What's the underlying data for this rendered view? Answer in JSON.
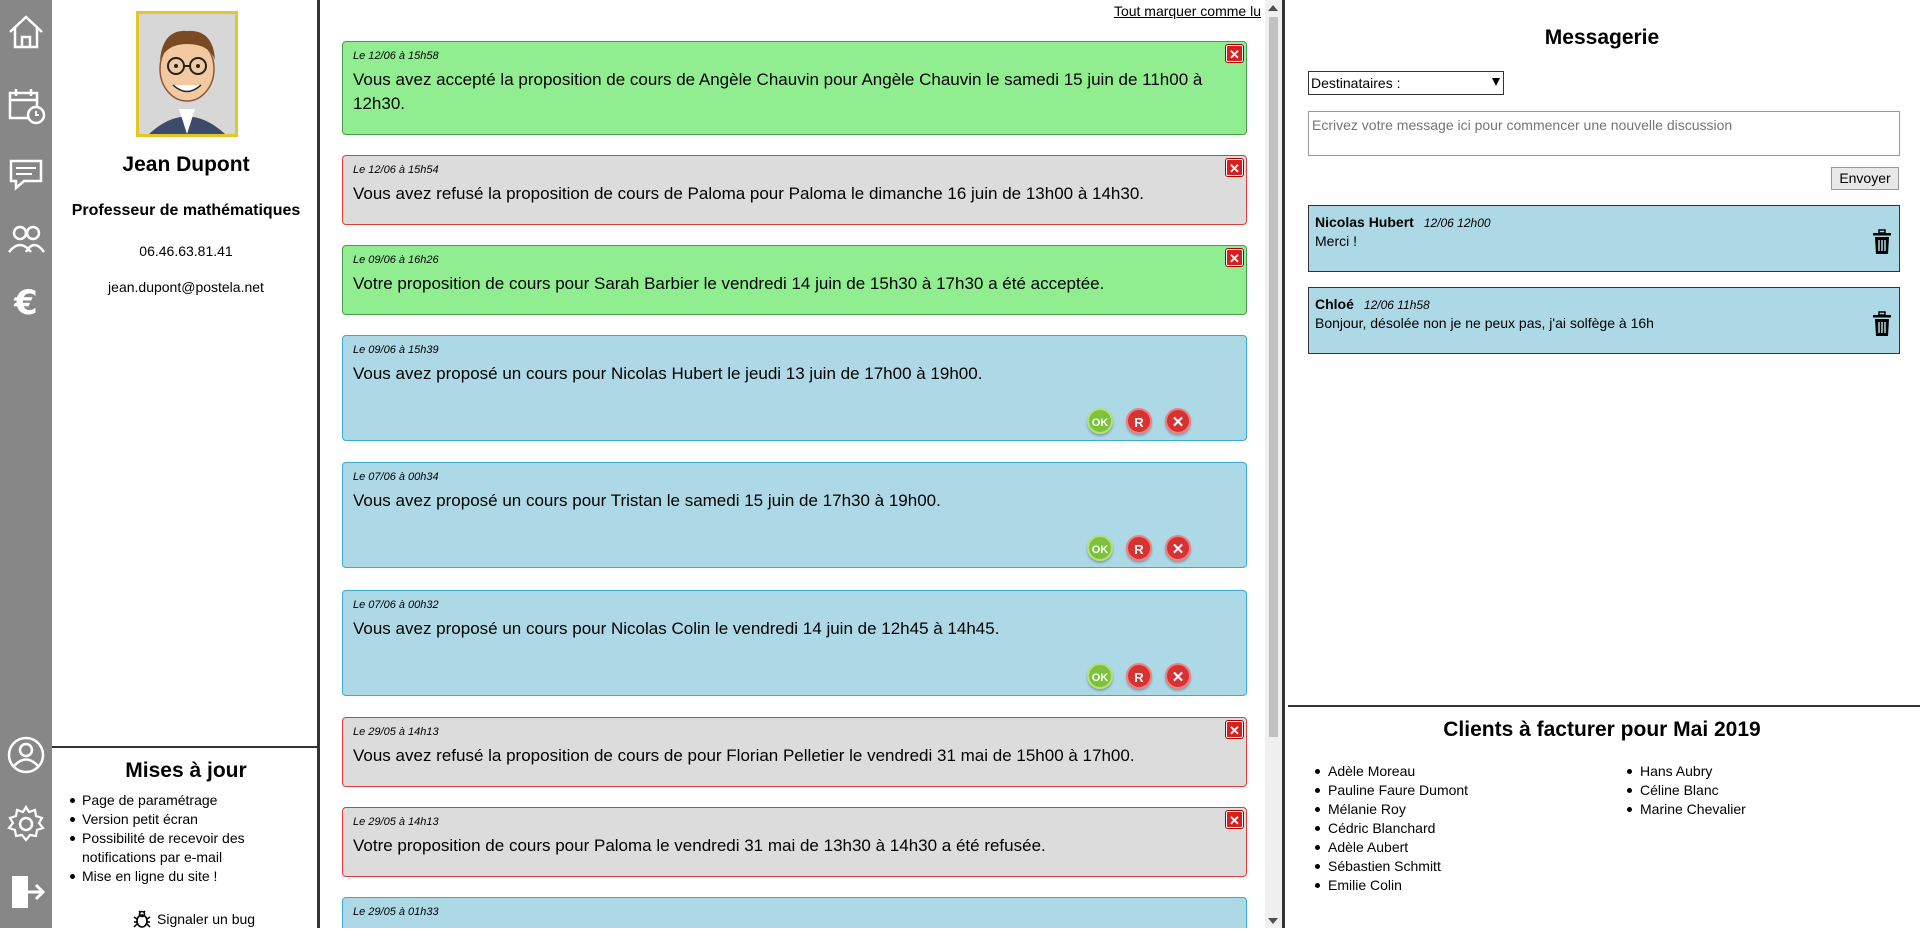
{
  "profile": {
    "name": "Jean Dupont",
    "role": "Professeur de mathématiques",
    "phone": "06.46.63.81.41",
    "email": "jean.dupont@postela.net"
  },
  "nav": {
    "icons": [
      "home-icon",
      "calendar-icon",
      "chat-icon",
      "users-icon",
      "euro-icon",
      "account-icon",
      "gear-icon",
      "logout-icon"
    ]
  },
  "updates": {
    "title": "Mises à jour",
    "items": [
      "Page de paramétrage",
      "Version petit écran",
      "Possibilité de recevoir des notifications par e-mail",
      "Mise en ligne du site !"
    ],
    "bug_label": "Signaler un bug"
  },
  "notifications": {
    "mark_all_label": "Tout marquer comme lu",
    "items": [
      {
        "date": "Le 12/06 à 15h58",
        "text": "Vous avez accepté la proposition de cours de Angèle Chauvin pour Angèle Chauvin le samedi 15 juin de 11h00 à 12h30.",
        "status": "accepted"
      },
      {
        "date": "Le 12/06 à 15h54",
        "text": "Vous avez refusé la proposition de cours de Paloma pour Paloma le dimanche 16 juin de 13h00 à 14h30.",
        "status": "refused"
      },
      {
        "date": "Le 09/06 à 16h26",
        "text": "Votre proposition de cours pour Sarah Barbier le vendredi 14 juin de 15h30 à 17h30 a été acceptée.",
        "status": "accepted"
      },
      {
        "date": "Le 09/06 à 15h39",
        "text": "Vous avez proposé un cours pour Nicolas Hubert le jeudi 13 juin de 17h00 à 19h00.",
        "status": "pending"
      },
      {
        "date": "Le 07/06 à 00h34",
        "text": "Vous avez proposé un cours pour Tristan le samedi 15 juin de 17h30 à 19h00.",
        "status": "pending"
      },
      {
        "date": "Le 07/06 à 00h32",
        "text": "Vous avez proposé un cours pour Nicolas Colin le vendredi 14 juin de 12h45 à 14h45.",
        "status": "pending"
      },
      {
        "date": "Le 29/05 à 14h13",
        "text": "Vous avez refusé la proposition de cours de pour Florian Pelletier le vendredi 31 mai de 15h00 à 17h00.",
        "status": "refused"
      },
      {
        "date": "Le 29/05 à 14h13",
        "text": "Votre proposition de cours pour Paloma le vendredi 31 mai de 13h30 à 14h30 a été refusée.",
        "status": "refused"
      },
      {
        "date": "Le 29/05 à 01h33",
        "text": "",
        "status": "pending"
      }
    ],
    "action_labels": {
      "ok": "OK",
      "r": "R",
      "x": "✕"
    }
  },
  "messaging": {
    "title": "Messagerie",
    "recipients_label": "Destinataires :",
    "message_placeholder": "Ecrivez votre message ici pour commencer une nouvelle discussion",
    "send_label": "Envoyer",
    "threads": [
      {
        "name": "Nicolas Hubert",
        "time": "12/06 12h00",
        "text": "Merci !"
      },
      {
        "name": "Chloé",
        "time": "12/06 11h58",
        "text": "Bonjour, désolée non je ne peux pas, j'ai solfège à 16h"
      }
    ]
  },
  "billing": {
    "title": "Clients à facturer pour Mai 2019",
    "col1": [
      "Adèle Moreau",
      "Pauline Faure Dumont",
      "Mélanie Roy",
      "Cédric Blanchard",
      "Adèle Aubert",
      "Sébastien Schmitt",
      "Emilie Colin"
    ],
    "col2": [
      "Hans Aubry",
      "Céline Blanc",
      "Marine Chevalier"
    ]
  },
  "colors": {
    "accepted": "#90ee90",
    "refused": "#dcdcdc",
    "pending": "#add8e6",
    "rail": "#878787"
  }
}
